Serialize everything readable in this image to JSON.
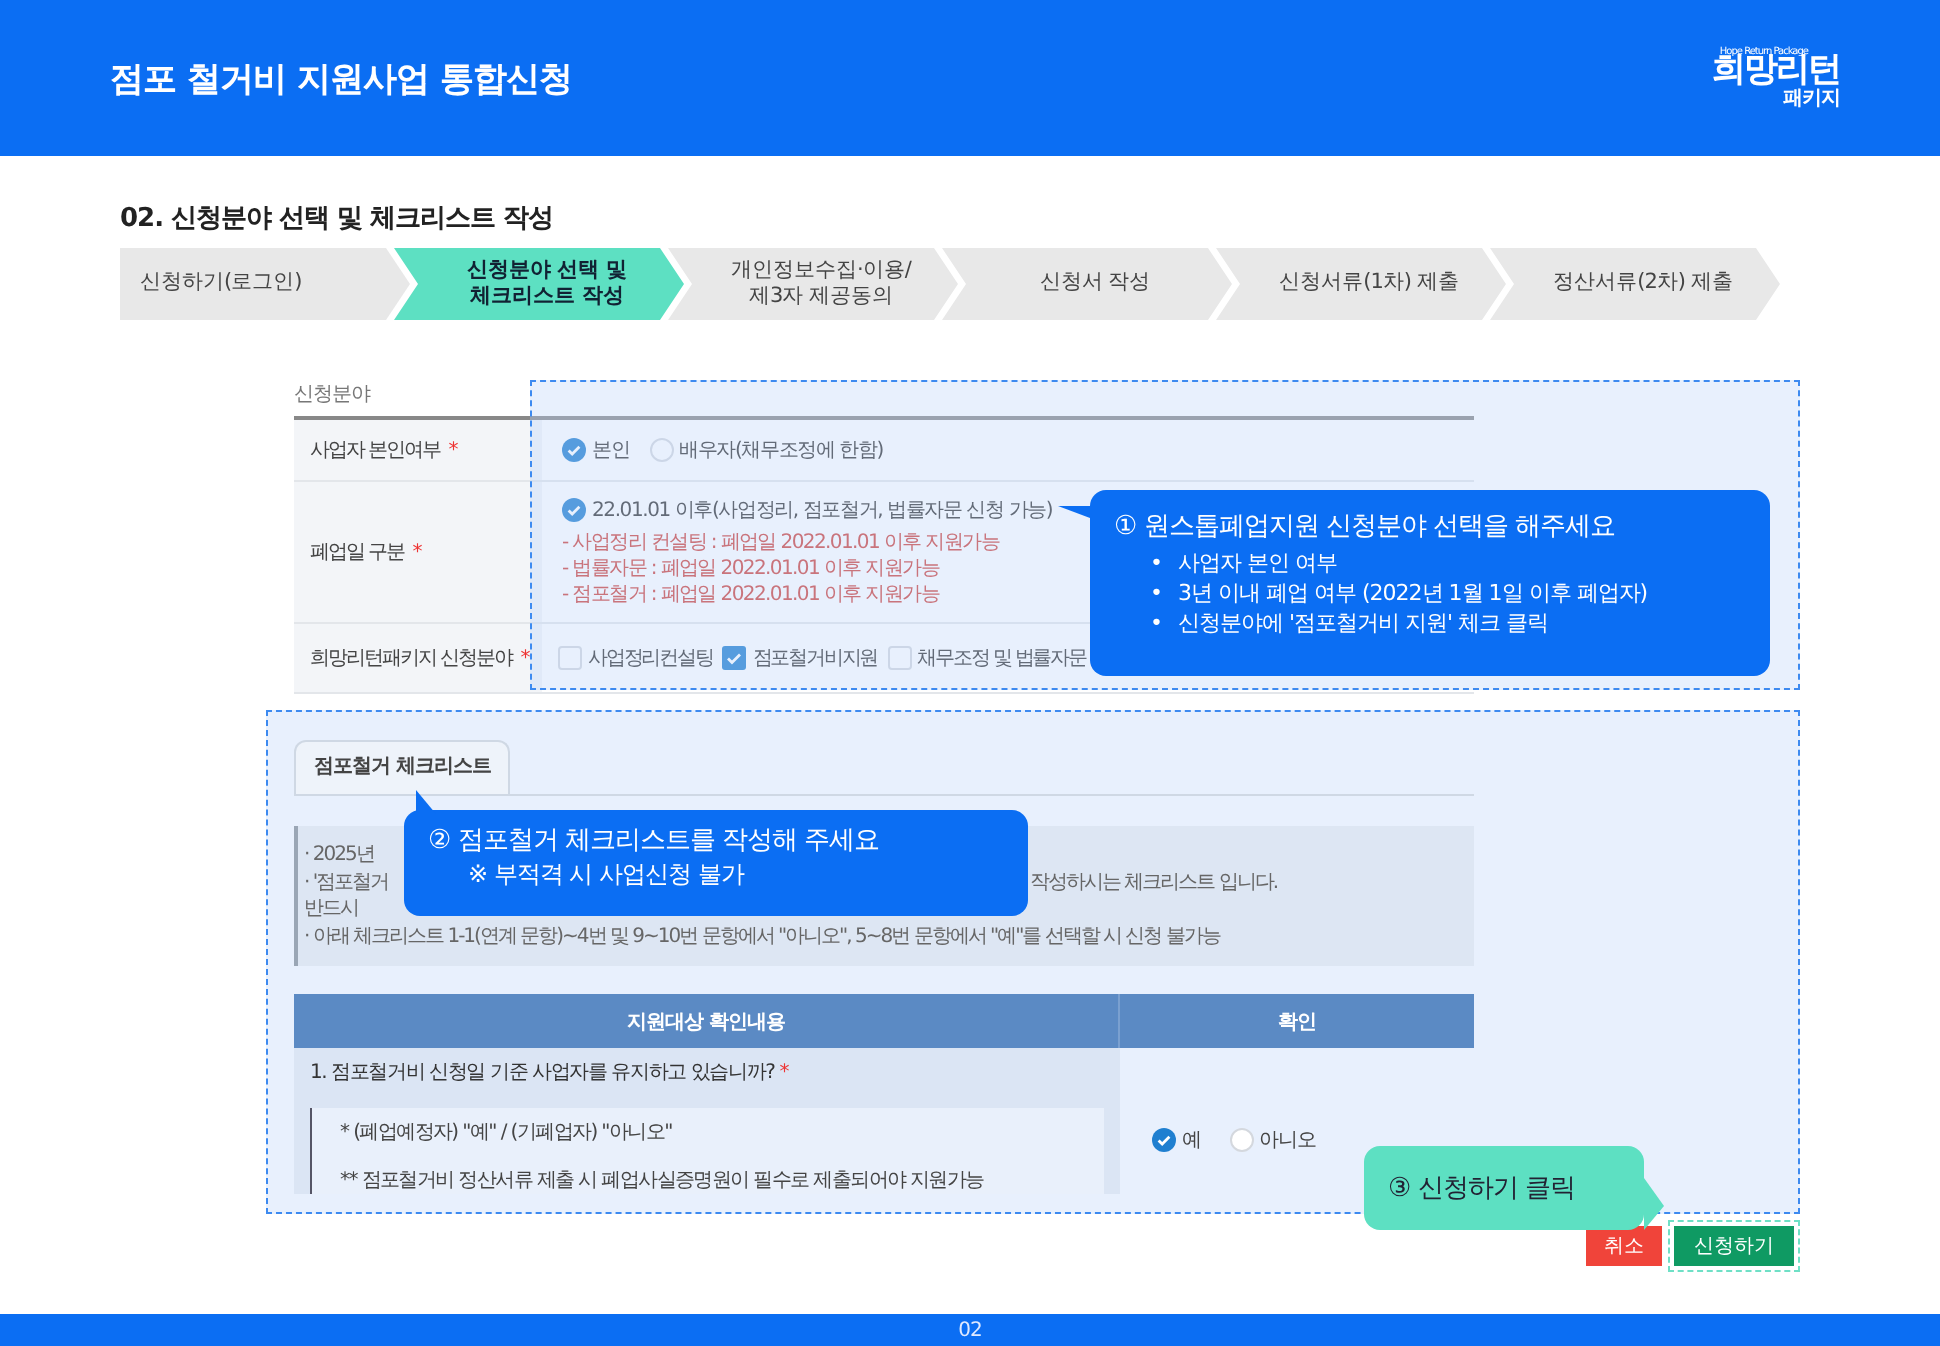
{
  "header": {
    "title": "점포 철거비 지원사업 통합신청",
    "logo": {
      "main": "희망리턴",
      "tagline": "Hope Return Package",
      "sub": "패키지"
    }
  },
  "section_title": "02. 신청분야 선택 및 체크리스트 작성",
  "steps": [
    {
      "label": "신청하기(로그인)",
      "selected": false
    },
    {
      "label": "신청분야 선택 및\n체크리스트 작성",
      "selected": true
    },
    {
      "label": "개인정보수집·이용/\n제3자 제공동의",
      "selected": false
    },
    {
      "label": "신청서 작성",
      "selected": false
    },
    {
      "label": "신청서류(1차) 제출",
      "selected": false
    },
    {
      "label": "정산서류(2차) 제출",
      "selected": false
    }
  ],
  "form": {
    "caption": "신청분야",
    "rows": [
      {
        "kind": "radio",
        "label": "사업자 본인여부",
        "mark": "*",
        "options": [
          {
            "label": "본인",
            "selected": true
          },
          {
            "label": "배우자(채무조정에 한함)",
            "selected": false
          }
        ]
      },
      {
        "kind": "closure",
        "label": "폐업일 구분",
        "mark": "*",
        "options": [
          {
            "label": "22.01.01 이후(사업정리, 점포철거, 법률자문 신청 가능)",
            "selected": true
          }
        ],
        "notes": [
          "- 사업정리 컨설팅 : 폐업일 2022.01.01 이후 지원가능",
          "- 법률자문 : 폐업일 2022.01.01 이후 지원가능",
          "- 점포철거 : 폐업일 2022.01.01 이후 지원가능"
        ]
      },
      {
        "kind": "checkbox",
        "label": "희망리턴패키지 신청분야",
        "mark": "*",
        "options": [
          {
            "label": "사업정리컨설팅",
            "checked": false
          },
          {
            "label": "점포철거비지원",
            "checked": true
          },
          {
            "label": "채무조정 및 법률자문",
            "checked": false
          }
        ]
      }
    ]
  },
  "checklist": {
    "tab": "점포철거 체크리스트",
    "notices": [
      {
        "left": "· 2025년"
      },
      {
        "left": "· '점포철거",
        "right": "작성하시는 체크리스트 입니다."
      },
      {
        "left": "반드시"
      },
      {
        "left": "· 아래 체크리스트 1-1(연계 문항)~4번 및 9~10번 문항에서 \"아니오\", 5~8번 문항에서 \"예\"를 선택할 시 신청 불가능"
      }
    ],
    "columns": [
      "지원대상 확인내용",
      "확인"
    ],
    "question": "1. 점포철거비 신청일 기준 사업자를 유지하고 있습니까?",
    "question_mark": "*",
    "details": [
      "* (폐업예정자) \"예\" / (기폐업자) \"아니오\"",
      "** 점포철거비 정산서류 제출 시 폐업사실증명원이 필수로 제출되어야 지원가능"
    ],
    "answers": [
      {
        "label": "예",
        "selected": true
      },
      {
        "label": "아니오",
        "selected": false
      }
    ]
  },
  "buttons": [
    {
      "label": "취소",
      "kind": "cancel"
    },
    {
      "label": "신청하기",
      "kind": "submit"
    }
  ],
  "callouts": [
    {
      "kind": "info",
      "number": "①",
      "title": "원스톱폐업지원 신청분야 선택을 해주세요",
      "bullets": [
        {
          "marker": "•",
          "text": "사업자 본인 여부"
        },
        {
          "marker": "•",
          "text": "3년 이내 폐업 여부 (2022년 1월 1일 이후 폐업자)"
        },
        {
          "marker": "•",
          "text": "신청분야에 '점포철거비 지원' 체크 클릭"
        }
      ]
    },
    {
      "kind": "info",
      "number": "②",
      "title": "점포철거 체크리스트를 작성해 주세요",
      "note": "※ 부적격 시 사업신청 불가"
    },
    {
      "kind": "action",
      "number": "③",
      "title": "신청하기 클릭"
    }
  ],
  "footer": {
    "page": "02"
  }
}
